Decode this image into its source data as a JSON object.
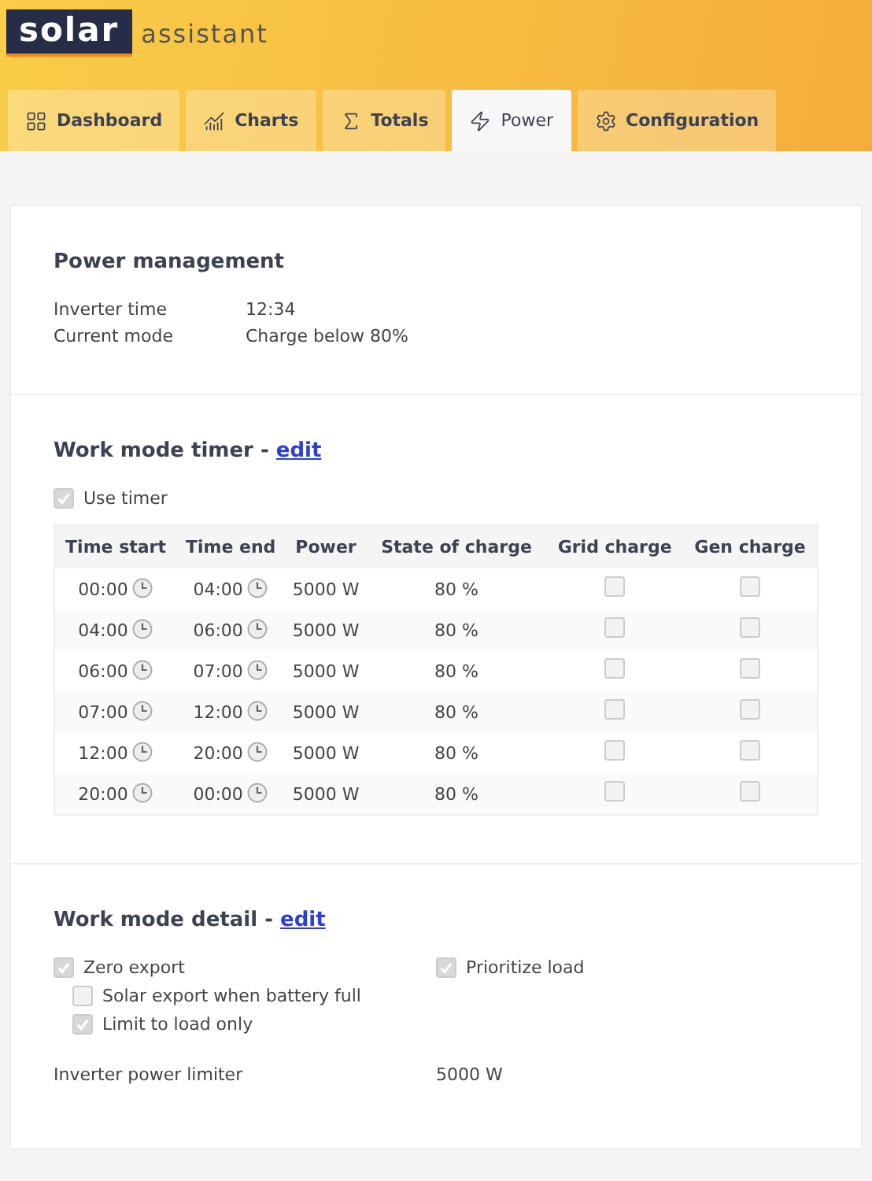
{
  "brand": {
    "logo": "solar",
    "name": "assistant"
  },
  "tabs": [
    {
      "label": "Dashboard",
      "kind": "grid",
      "selected": false
    },
    {
      "label": "Charts",
      "kind": "chart",
      "selected": false
    },
    {
      "label": "Totals",
      "kind": "sigma",
      "selected": false
    },
    {
      "label": "Power",
      "kind": "bolt",
      "selected": true
    },
    {
      "label": "Configuration",
      "kind": "gear",
      "selected": false
    }
  ],
  "sections": [
    {
      "kind": "info",
      "title": "Power management",
      "rows": [
        {
          "label": "Inverter time",
          "value": "12:34"
        },
        {
          "label": "Current mode",
          "value": "Charge below 80%"
        }
      ]
    },
    {
      "kind": "timer",
      "title": "Work mode timer -",
      "link": "edit",
      "use_timer": {
        "label": "Use timer",
        "checked": true
      },
      "columns": [
        "Time start",
        "Time end",
        "Power",
        "State of charge",
        "Grid charge",
        "Gen charge"
      ],
      "rows": [
        {
          "start": "00:00",
          "end": "04:00",
          "power": "5000 W",
          "soc": "80 %",
          "grid_charge": false,
          "gen_charge": false
        },
        {
          "start": "04:00",
          "end": "06:00",
          "power": "5000 W",
          "soc": "80 %",
          "grid_charge": false,
          "gen_charge": false
        },
        {
          "start": "06:00",
          "end": "07:00",
          "power": "5000 W",
          "soc": "80 %",
          "grid_charge": false,
          "gen_charge": false
        },
        {
          "start": "07:00",
          "end": "12:00",
          "power": "5000 W",
          "soc": "80 %",
          "grid_charge": false,
          "gen_charge": false
        },
        {
          "start": "12:00",
          "end": "20:00",
          "power": "5000 W",
          "soc": "80 %",
          "grid_charge": false,
          "gen_charge": false
        },
        {
          "start": "20:00",
          "end": "00:00",
          "power": "5000 W",
          "soc": "80 %",
          "grid_charge": false,
          "gen_charge": false
        }
      ]
    },
    {
      "kind": "detail",
      "title": "Work mode detail -",
      "link": "edit",
      "option_columns": [
        [
          {
            "label": "Zero export",
            "checked": true,
            "children": [
              {
                "label": "Solar export when battery full",
                "checked": false
              },
              {
                "label": "Limit to load only",
                "checked": true
              }
            ]
          }
        ],
        [
          {
            "label": "Prioritize load",
            "checked": true
          }
        ]
      ],
      "rows": [
        {
          "label": "Inverter power limiter",
          "value": "5000 W"
        }
      ]
    }
  ]
}
